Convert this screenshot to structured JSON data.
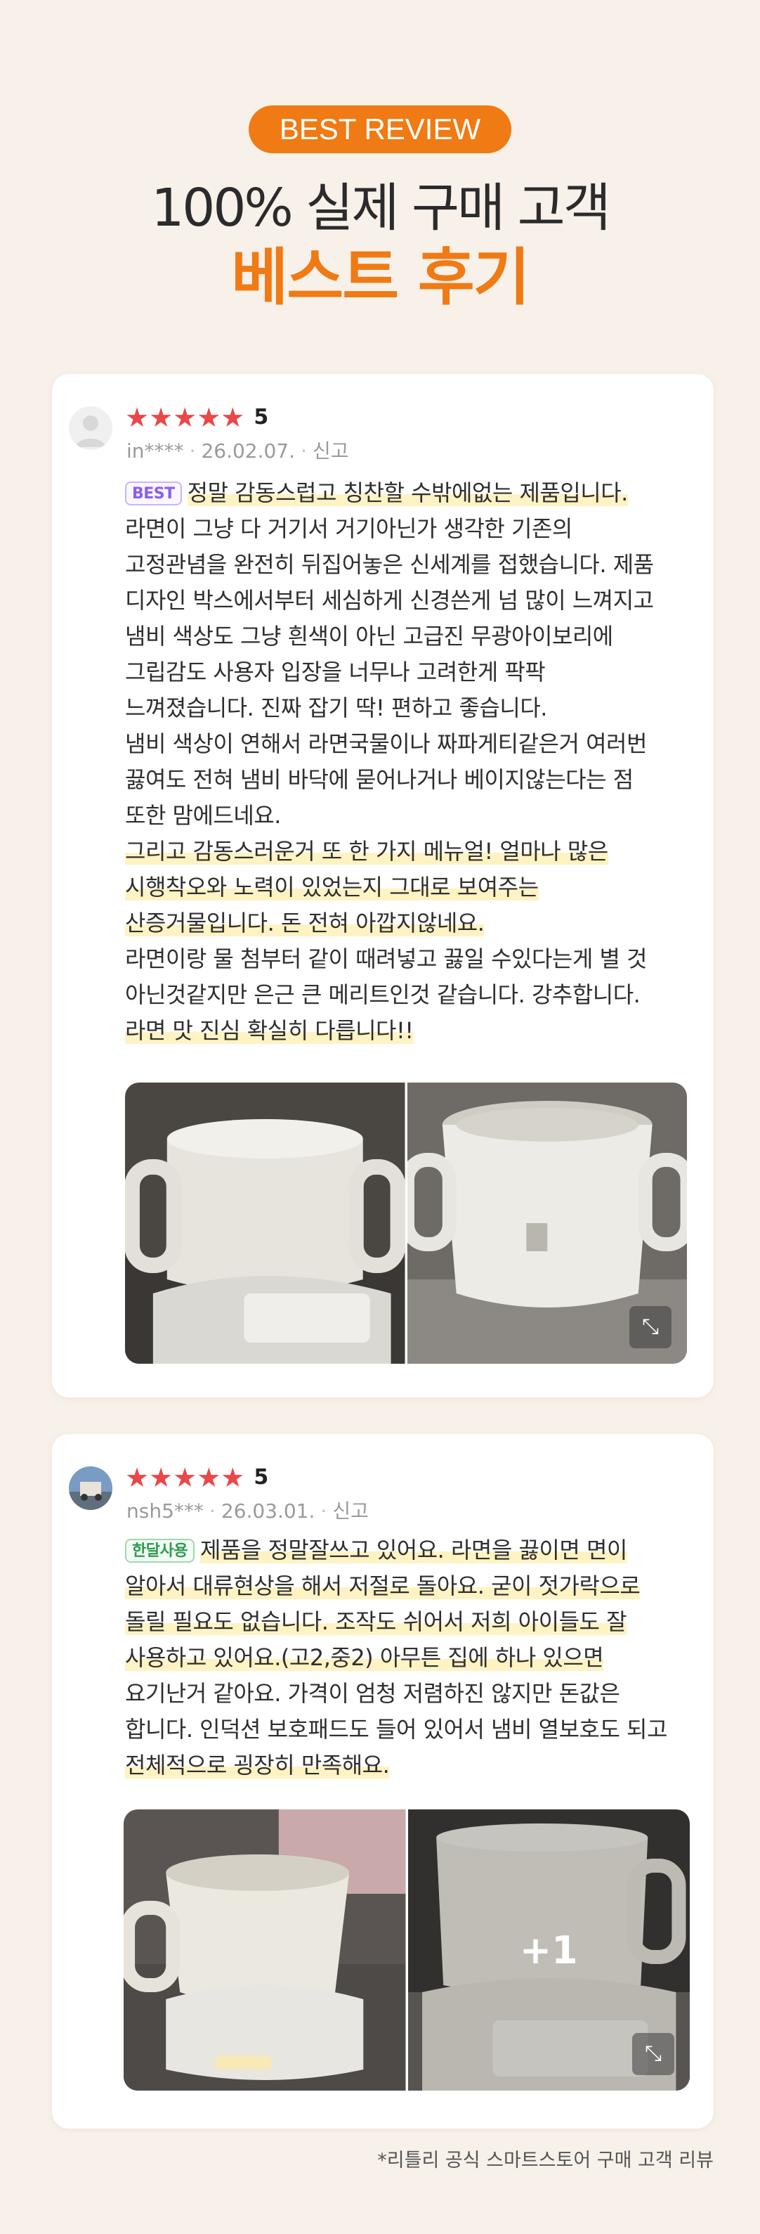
{
  "header": {
    "pill": "BEST REVIEW",
    "title": "100% 실제 구매 고객",
    "title_accent": "베스트 후기"
  },
  "colors": {
    "accent": "#f07a13",
    "star": "#e94848",
    "highlight": "#fff3c4",
    "background": "#f8f1ea"
  },
  "reviews": [
    {
      "avatar_icon": "default-user-icon",
      "stars": "★★★★★",
      "rating": "5",
      "user": "in****",
      "date": "26.02.07.",
      "report": "신고",
      "badge": "BEST",
      "lines": [
        "정말 감동스럽고 칭찬할 수밖에없는 제품입니다.",
        "라면이 그냥 다 거기서 거기아닌가 생각한 기존의",
        "고정관념을 완전히 뒤집어놓은 신세계를 접했습니다. 제품",
        "디자인 박스에서부터 세심하게 신경쓴게 넘 많이 느껴지고",
        "냄비 색상도 그냥 흰색이 아닌 고급진 무광아이보리에",
        "그립감도 사용자 입장을 너무나 고려한게 팍팍",
        "느껴졌습니다. 진짜 잡기 딱! 편하고 좋습니다.",
        "냄비 색상이 연해서 라면국물이나 짜파게티같은거 여러번",
        "끓여도 전혀 냄비 바닥에 묻어나거나 베이지않는다는 점",
        "또한 맘에드네요.",
        "그리고 감동스러운거 또 한 가지 메뉴얼! 얼마나 많은",
        "시행착오와 노력이 있었는지 그대로 보여주는",
        "산증거물입니다. 돈 전혀 아깝지않네요.",
        "라면이랑 물 첨부터 같이 때려넣고 끓일 수있다는게 별 것",
        "아닌것같지만 은근 큰 메리트인것 같습니다. 강추합니다.",
        "라면 맛 진심 확실히 다릅니다!!"
      ],
      "expand_icon": "expand-icon"
    },
    {
      "avatar_icon": "profile-photo",
      "stars": "★★★★★",
      "rating": "5",
      "user": "nsh5***",
      "date": "26.03.01.",
      "report": "신고",
      "badge": "한달사용",
      "lines": [
        "제품을 정말잘쓰고 있어요. 라면을 끓이면 면이",
        "알아서 대류현상을 해서 저절로 돌아요. 굳이 젓가락으로",
        "돌릴 필요도 없습니다. 조작도 쉬어서 저희 아이들도 잘",
        "사용하고 있어요.(고2,중2) 아무튼 집에 하나 있으면",
        "요기난거 같아요. 가격이 엄청 저렴하진 않지만 돈값은",
        "합니다. 인덕션 보호패드도 들어 있어서 냄비 열보호도 되고",
        "전체적으로 굉장히 만족해요."
      ],
      "more_photos": "+1",
      "expand_icon": "expand-icon"
    }
  ],
  "footer": {
    "note": "*리틀리 공식 스마트스토어 구매 고객 리뷰"
  }
}
